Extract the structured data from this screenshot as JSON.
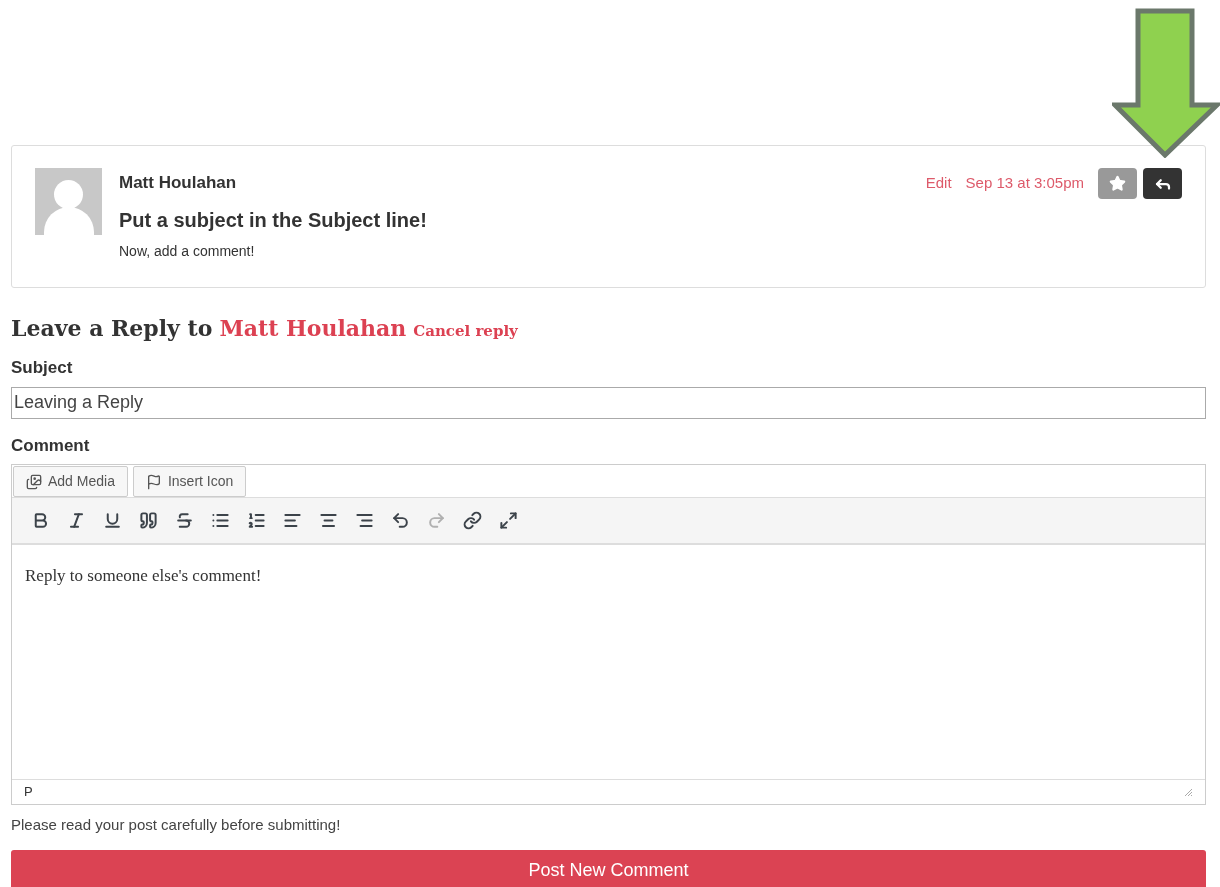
{
  "comment": {
    "author": "Matt Houlahan",
    "subject": "Put a subject in the Subject line!",
    "body": "Now, add a comment!",
    "edit_link": "Edit",
    "date": "Sep 13 at 3:05pm"
  },
  "reply_form": {
    "heading": "Leave a Reply to",
    "reply_to": "Matt Houlahan",
    "cancel": "Cancel reply",
    "subject_label": "Subject",
    "subject_value": "Leaving a Reply",
    "comment_label": "Comment",
    "media_buttons": [
      {
        "kind": "media",
        "label": "Add Media"
      },
      {
        "kind": "flag",
        "label": "Insert Icon"
      }
    ],
    "toolbar": [
      {
        "kind": "bold",
        "disabled": false
      },
      {
        "kind": "italic",
        "disabled": false
      },
      {
        "kind": "underline",
        "disabled": false
      },
      {
        "kind": "quote",
        "disabled": false
      },
      {
        "kind": "strike",
        "disabled": false
      },
      {
        "kind": "bullets",
        "disabled": false
      },
      {
        "kind": "numbers",
        "disabled": false
      },
      {
        "kind": "align-left",
        "disabled": false
      },
      {
        "kind": "align-center",
        "disabled": false
      },
      {
        "kind": "align-right",
        "disabled": false
      },
      {
        "kind": "undo",
        "disabled": false
      },
      {
        "kind": "redo",
        "disabled": true
      },
      {
        "kind": "link",
        "disabled": false
      },
      {
        "kind": "fullscreen",
        "disabled": false
      }
    ],
    "editor_text": "Reply to someone else's comment!",
    "path": "P",
    "note": "Please read your post carefully before submitting!",
    "submit": "Post New Comment"
  }
}
